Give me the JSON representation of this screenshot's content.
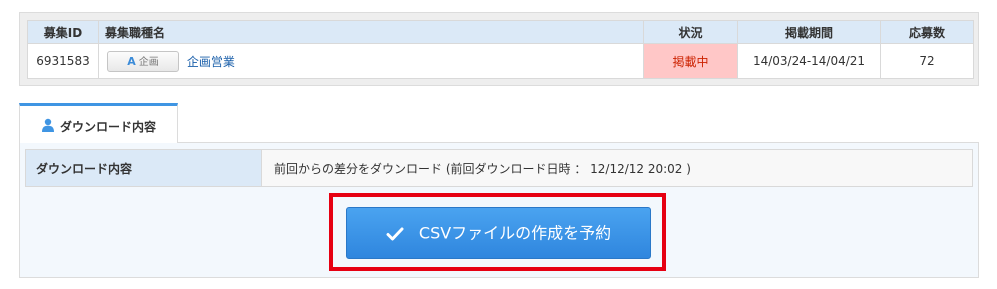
{
  "job_table": {
    "headers": {
      "id": "募集ID",
      "name": "募集職種名",
      "status": "状況",
      "period": "掲載期間",
      "count": "応募数"
    },
    "row": {
      "id": "6931583",
      "category_prefix": "A",
      "category": "企画",
      "name": "企画営業",
      "status": "掲載中",
      "period": "14/03/24-14/04/21",
      "count": "72"
    }
  },
  "tab": {
    "label": "ダウンロード内容",
    "icon": "user-icon"
  },
  "download": {
    "label": "ダウンロード内容",
    "value": "前回からの差分をダウンロード (前回ダウンロード日時 ： 12/12/12 20:02 )"
  },
  "button": {
    "label": "CSVファイルの作成を予約",
    "icon": "check-icon"
  },
  "colors": {
    "accent": "#3f95e3",
    "button": "#3a92e6",
    "header_bg": "#dbe9f7",
    "status_bg": "#ffc7c7",
    "highlight": "#e60012"
  }
}
